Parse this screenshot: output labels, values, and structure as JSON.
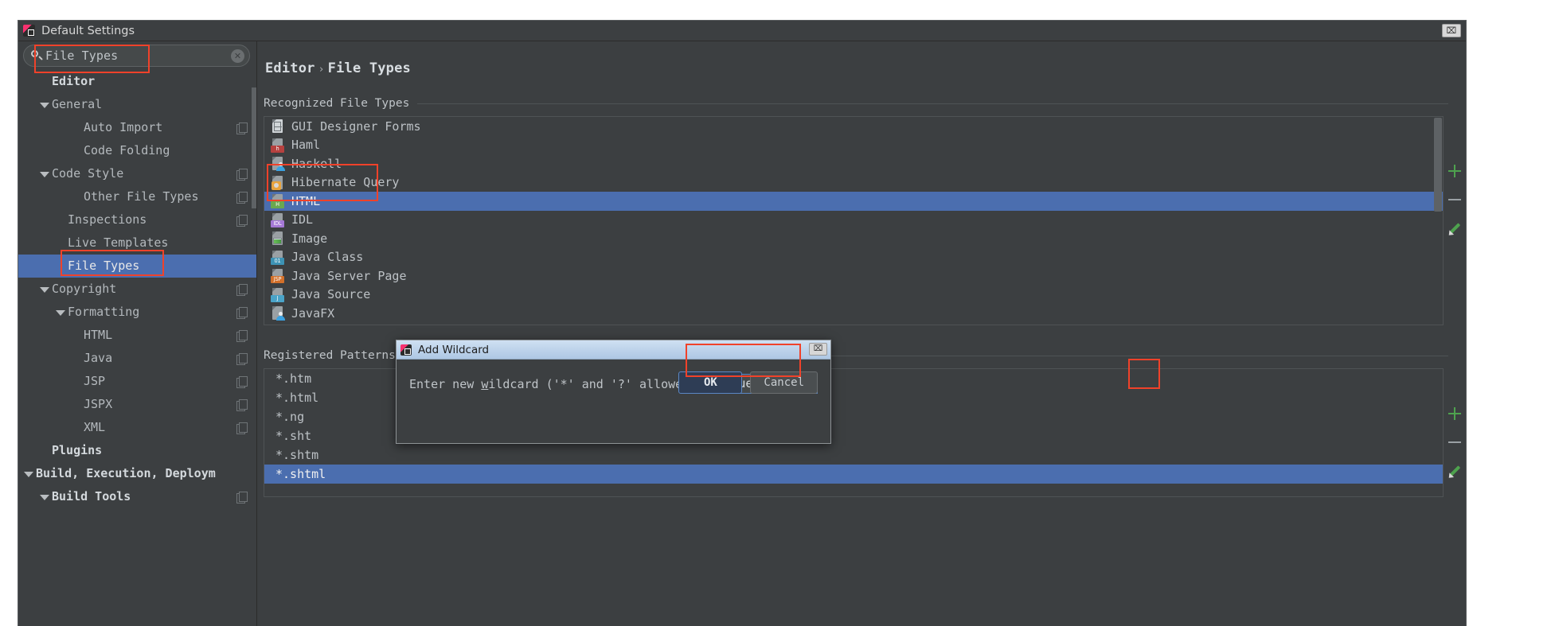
{
  "window": {
    "title": "Default Settings",
    "close_label": "⌧"
  },
  "search": {
    "value": "File Types",
    "icon": "search-icon",
    "clear_icon": "✕"
  },
  "sidebar": {
    "items": [
      {
        "label": "Editor",
        "indent": 1,
        "arrow": false,
        "bold": true,
        "selected": false,
        "copy": false
      },
      {
        "label": "General",
        "indent": 1,
        "arrow": true,
        "bold": false,
        "selected": false,
        "copy": false
      },
      {
        "label": "Auto Import",
        "indent": 3,
        "arrow": false,
        "bold": false,
        "selected": false,
        "copy": true
      },
      {
        "label": "Code Folding",
        "indent": 3,
        "arrow": false,
        "bold": false,
        "selected": false,
        "copy": false
      },
      {
        "label": "Code Style",
        "indent": 1,
        "arrow": true,
        "bold": false,
        "selected": false,
        "copy": true
      },
      {
        "label": "Other File Types",
        "indent": 3,
        "arrow": false,
        "bold": false,
        "selected": false,
        "copy": true
      },
      {
        "label": "Inspections",
        "indent": 2,
        "arrow": false,
        "bold": false,
        "selected": false,
        "copy": true
      },
      {
        "label": "Live Templates",
        "indent": 2,
        "arrow": false,
        "bold": false,
        "selected": false,
        "copy": false
      },
      {
        "label": "File Types",
        "indent": 2,
        "arrow": false,
        "bold": false,
        "selected": true,
        "copy": false
      },
      {
        "label": "Copyright",
        "indent": 1,
        "arrow": true,
        "bold": false,
        "selected": false,
        "copy": true
      },
      {
        "label": "Formatting",
        "indent": 2,
        "arrow": true,
        "bold": false,
        "selected": false,
        "copy": true
      },
      {
        "label": "HTML",
        "indent": 3,
        "arrow": false,
        "bold": false,
        "selected": false,
        "copy": true
      },
      {
        "label": "Java",
        "indent": 3,
        "arrow": false,
        "bold": false,
        "selected": false,
        "copy": true
      },
      {
        "label": "JSP",
        "indent": 3,
        "arrow": false,
        "bold": false,
        "selected": false,
        "copy": true
      },
      {
        "label": "JSPX",
        "indent": 3,
        "arrow": false,
        "bold": false,
        "selected": false,
        "copy": true
      },
      {
        "label": "XML",
        "indent": 3,
        "arrow": false,
        "bold": false,
        "selected": false,
        "copy": true
      },
      {
        "label": "Plugins",
        "indent": 1,
        "arrow": false,
        "bold": true,
        "selected": false,
        "copy": false
      },
      {
        "label": "Build, Execution, Deploym",
        "indent": 0,
        "arrow": true,
        "bold": true,
        "selected": false,
        "copy": false
      },
      {
        "label": "Build Tools",
        "indent": 1,
        "arrow": true,
        "bold": true,
        "selected": false,
        "copy": true
      }
    ]
  },
  "main": {
    "breadcrumb_root": "Editor",
    "breadcrumb_sep": "›",
    "breadcrumb_leaf": "File Types",
    "recognized_label": "Recognized File Types",
    "patterns_label": "Registered Patterns",
    "recognized": [
      {
        "name": "GUI Designer Forms",
        "icon": "gui",
        "tag": "",
        "tagcolor": "#8c9296",
        "selected": false
      },
      {
        "name": "Haml",
        "icon": "tag",
        "tag": "h",
        "tagcolor": "#b6413f",
        "selected": false
      },
      {
        "name": "Haskell",
        "icon": "person",
        "tag": "",
        "tagcolor": "#3ba1e0",
        "selected": false
      },
      {
        "name": "Hibernate Query",
        "icon": "hib",
        "tag": "",
        "tagcolor": "#e8a33d",
        "selected": false
      },
      {
        "name": "HTML",
        "icon": "tag",
        "tag": "H",
        "tagcolor": "#6aa84f",
        "selected": true
      },
      {
        "name": "IDL",
        "icon": "tag",
        "tag": "IDL",
        "tagcolor": "#a579d6",
        "selected": false
      },
      {
        "name": "Image",
        "icon": "img",
        "tag": "",
        "tagcolor": "#6aa84f",
        "selected": false
      },
      {
        "name": "Java Class",
        "icon": "tag",
        "tag": "01",
        "tagcolor": "#3d93b5",
        "selected": false
      },
      {
        "name": "Java Server Page",
        "icon": "tag",
        "tag": "JSP",
        "tagcolor": "#d3702a",
        "selected": false
      },
      {
        "name": "Java Source",
        "icon": "tag",
        "tag": "J",
        "tagcolor": "#4aa3c8",
        "selected": false
      },
      {
        "name": "JavaFX",
        "icon": "person",
        "tag": "",
        "tagcolor": "#3ba1e0",
        "selected": false
      }
    ],
    "patterns": [
      {
        "name": "*.htm",
        "selected": false
      },
      {
        "name": "*.html",
        "selected": false
      },
      {
        "name": "*.ng",
        "selected": false
      },
      {
        "name": "*.sht",
        "selected": false
      },
      {
        "name": "*.shtm",
        "selected": false
      },
      {
        "name": "*.shtml",
        "selected": true
      }
    ],
    "toolbar": {
      "add_icon": "plus-icon",
      "remove_icon": "minus-icon",
      "edit_icon": "pencil-icon"
    }
  },
  "dialog": {
    "title": "Add Wildcard",
    "close_label": "⌧",
    "prompt_before": "Enter new ",
    "prompt_mnemonic": "w",
    "prompt_after": "ildcard ('*' and '?' allowed):",
    "input_value": "*.vue",
    "ok_label": "OK",
    "cancel_label": "Cancel"
  },
  "annotations": {
    "accent_color": "#f0422a"
  }
}
